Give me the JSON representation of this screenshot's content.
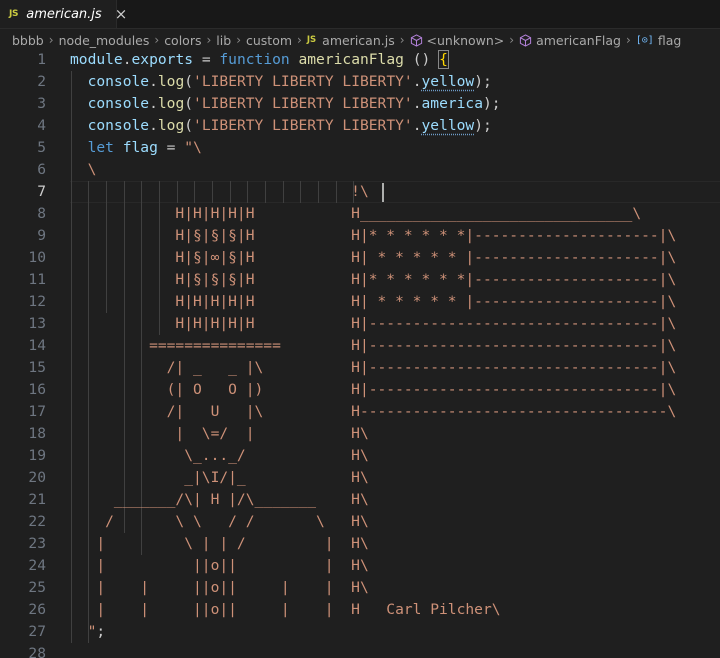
{
  "tab": {
    "badge": "JS",
    "filename": "american.js",
    "close_glyph": "×"
  },
  "breadcrumb": {
    "items": [
      "bbbb",
      "node_modules",
      "colors",
      "lib",
      "custom",
      "american.js",
      "<unknown>",
      "americanFlag",
      "flag"
    ],
    "separator": "›",
    "js_badge": "JS",
    "var_badge": "[⊙]"
  },
  "editor": {
    "active_line": 7,
    "lines": [
      {
        "num": "1",
        "text": "module.exports = function americanFlag () {"
      },
      {
        "num": "2",
        "text": "  console.log('LIBERTY LIBERTY LIBERTY'.yellow);"
      },
      {
        "num": "3",
        "text": "  console.log('LIBERTY LIBERTY LIBERTY'.america);"
      },
      {
        "num": "4",
        "text": "  console.log('LIBERTY LIBERTY LIBERTY'.yellow);"
      },
      {
        "num": "5",
        "text": "  let flag = \"\\"
      },
      {
        "num": "6",
        "text": "  \\"
      },
      {
        "num": "7",
        "text": "                                !\\"
      },
      {
        "num": "8",
        "text": "            H|H|H|H|H           H_______________________________\\"
      },
      {
        "num": "9",
        "text": "            H|§|§|§|H           H|* * * * * *|---------------------|\\"
      },
      {
        "num": "10",
        "text": "            H|§|∞|§|H           H| * * * * * |---------------------|\\"
      },
      {
        "num": "11",
        "text": "            H|§|§|§|H           H|* * * * * *|---------------------|\\"
      },
      {
        "num": "12",
        "text": "            H|H|H|H|H           H| * * * * * |---------------------|\\"
      },
      {
        "num": "13",
        "text": "            H|H|H|H|H           H|---------------------------------|\\"
      },
      {
        "num": "14",
        "text": "         ===============        H|---------------------------------|\\"
      },
      {
        "num": "15",
        "text": "           /| _   _ |\\          H|---------------------------------|\\"
      },
      {
        "num": "16",
        "text": "           (| O   O |)          H|---------------------------------|\\"
      },
      {
        "num": "17",
        "text": "           /|   U   |\\          H-----------------------------------\\"
      },
      {
        "num": "18",
        "text": "            |  \\=/  |           H\\"
      },
      {
        "num": "19",
        "text": "             \\_..._/            H\\"
      },
      {
        "num": "20",
        "text": "             _|\\I/|_            H\\"
      },
      {
        "num": "21",
        "text": "     _______/\\| H |/\\_______    H\\"
      },
      {
        "num": "22",
        "text": "    /       \\ \\   / /       \\   H\\"
      },
      {
        "num": "23",
        "text": "   |         \\ | | /         |  H\\"
      },
      {
        "num": "24",
        "text": "   |          ||o||          |  H\\"
      },
      {
        "num": "25",
        "text": "   |    |     ||o||     |    |  H\\"
      },
      {
        "num": "26",
        "text": "   |    |     ||o||     |    |  H   Carl Pilcher\\"
      },
      {
        "num": "27",
        "text": "  \";"
      },
      {
        "num": "28",
        "text": ""
      }
    ]
  },
  "colors": {
    "background": "#1f1f1f",
    "tabbar": "#181818",
    "string": "#ce9178",
    "keyword": "#569cd6",
    "function": "#dcdcaa",
    "variable": "#9cdcfe",
    "js_icon": "#cbcb41",
    "line_number": "#6e7681"
  }
}
